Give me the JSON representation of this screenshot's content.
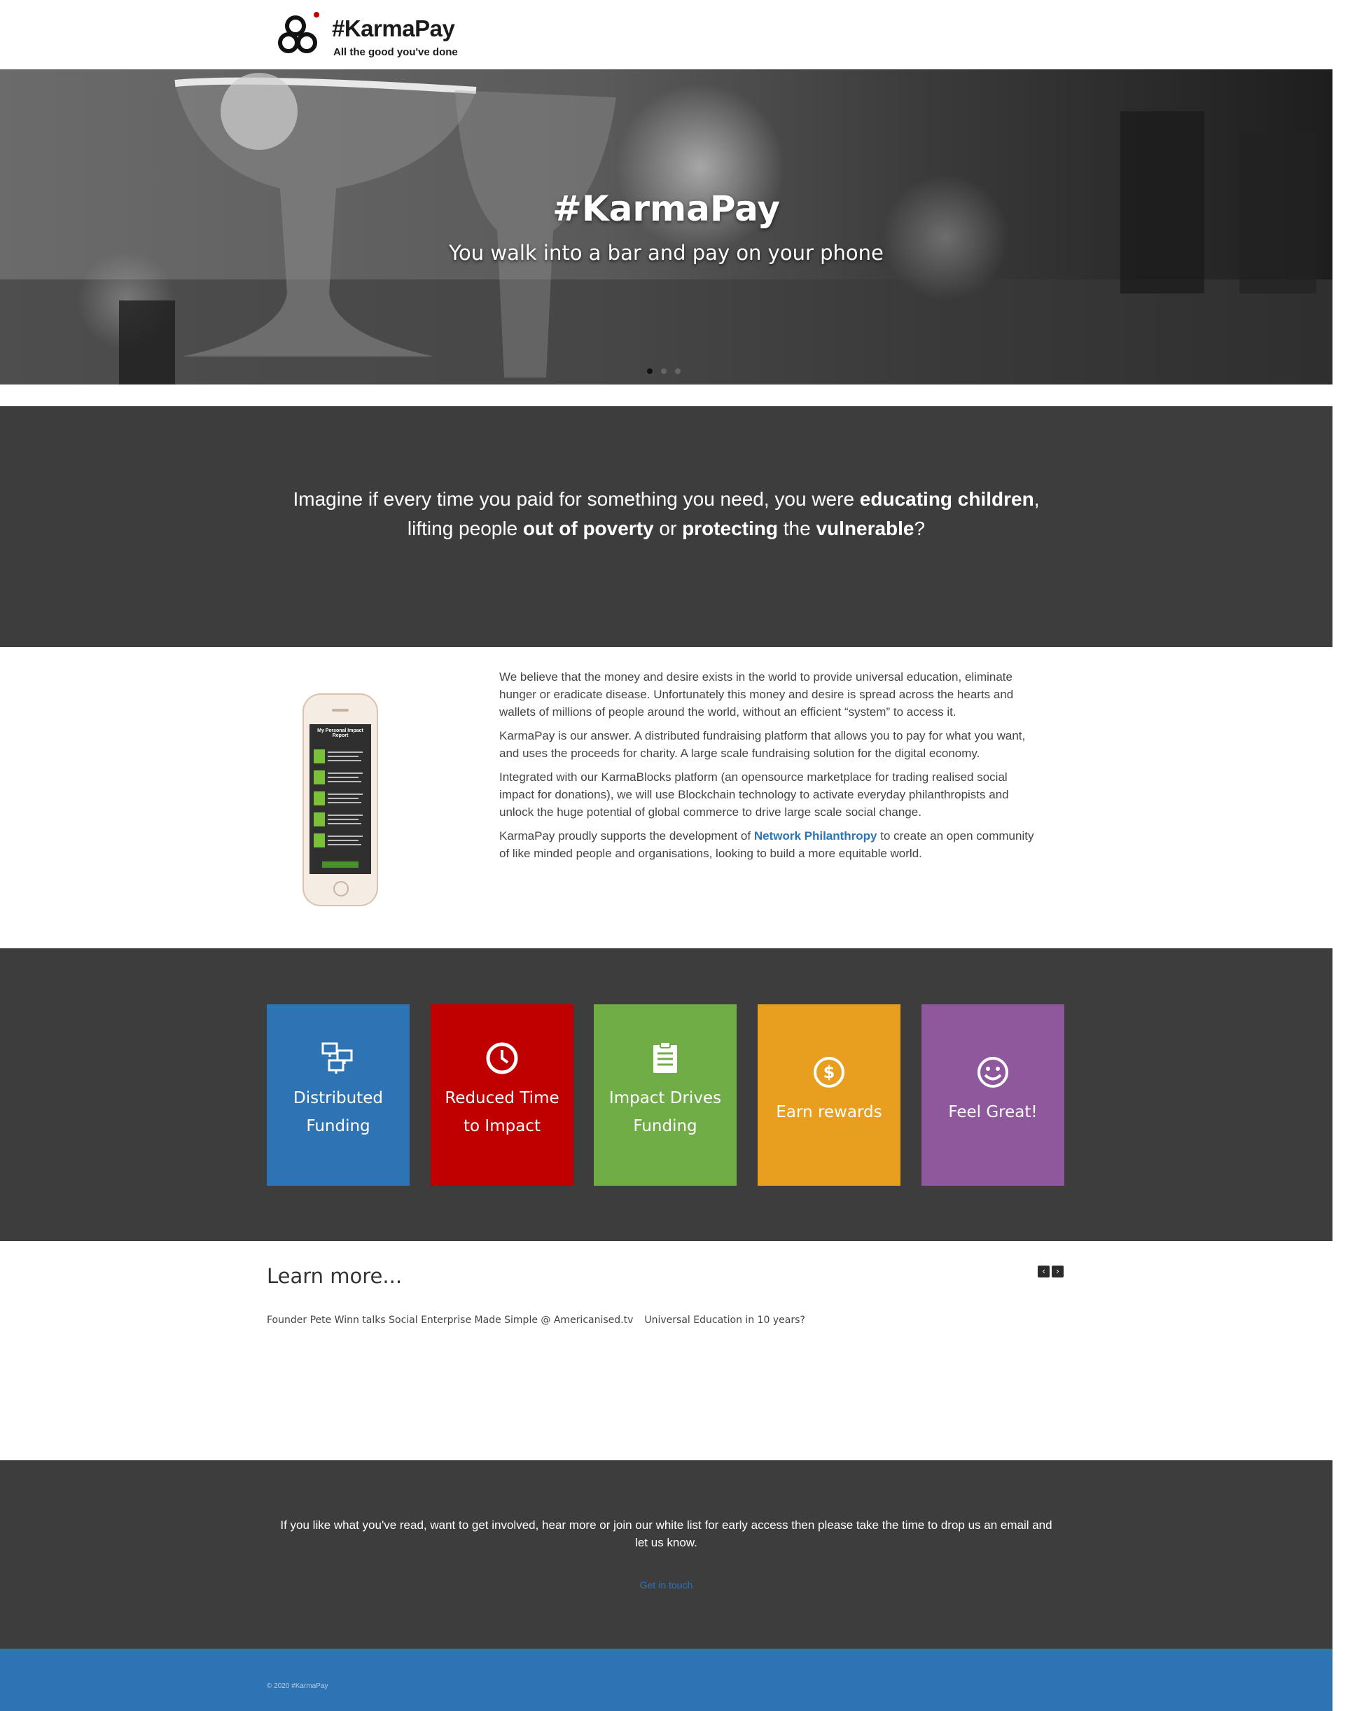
{
  "header": {
    "logo_title": "#KarmaPay",
    "logo_tagline": "All the good you've done"
  },
  "hero": {
    "title": "#KarmaPay",
    "subtitle": "You walk into a bar and pay on your phone",
    "slides": 3,
    "active_slide": 1
  },
  "imagine": {
    "p1": "Imagine if every time you paid for something you need, you were ",
    "b1": "educating children",
    "p2": ",",
    "p3": "lifting people ",
    "b2": "out of poverty",
    "p4": " or ",
    "b3": "protecting",
    "p5": " the ",
    "b4": "vulnerable",
    "p6": "?"
  },
  "about": {
    "phone_screen_title": "My Personal Impact Report",
    "para1": "We believe that the money and desire exists in the world to provide universal education, eliminate hunger or eradicate disease.  Unfortunately this money and desire is spread across the hearts and wallets of millions of people around the world, without an efficient “system” to access it.",
    "para2": "KarmaPay is our answer.  A distributed fundraising platform that allows you to pay for what you want, and uses the proceeds for charity.  A large scale fundraising solution for the digital economy.",
    "para3": "Integrated with our KarmaBlocks platform (an opensource marketplace for trading realised social impact for donations), we will use Blockchain technology to activate everyday philanthropists and unlock the huge potential of global commerce to drive large scale social change.",
    "para4_pre": "KarmaPay proudly supports the development of ",
    "para4_link": "Network Philanthropy",
    "para4_post": " to create an open community of like minded people and organisations, looking to build a more equitable world."
  },
  "features": [
    {
      "label": "Distributed Funding",
      "icon": "network-icon",
      "color": "#2e74b5"
    },
    {
      "label": "Reduced Time to Impact",
      "icon": "clock-icon",
      "color": "#c00000"
    },
    {
      "label": "Impact Drives Funding",
      "icon": "clipboard-icon",
      "color": "#70ad47"
    },
    {
      "label": "Earn rewards",
      "icon": "dollar-coin-icon",
      "color": "#e89e1f"
    },
    {
      "label": "Feel Great!",
      "icon": "smiley-icon",
      "color": "#8f579c"
    }
  ],
  "learn": {
    "title": "Learn more...",
    "prev": "‹",
    "next": "›",
    "videos": [
      "Founder Pete Winn talks Social Enterprise Made Simple @ Americanised.tv",
      "Universal Education in 10 years?"
    ]
  },
  "contact": {
    "text": "If you like what you've read, want to get involved, hear more or join our white list for early access then please take the time to drop us an email and let us know.",
    "link": "Get in touch"
  },
  "footer": {
    "copyright": "© 2020 #KarmaPay"
  }
}
